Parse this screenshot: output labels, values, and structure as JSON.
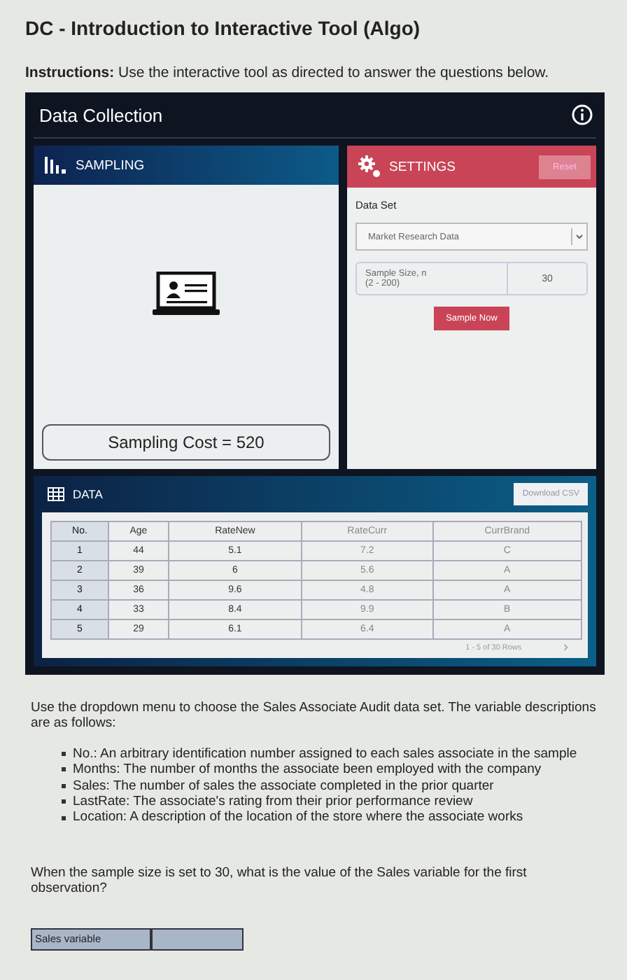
{
  "title": "DC - Introduction to Interactive Tool (Algo)",
  "instructions": "**Instructions:** Use the interactive tool as directed to answer the questions below.",
  "tool": {
    "title": "Data Collection",
    "sampling": {
      "header": "SAMPLING",
      "cost": "Sampling Cost = 520"
    },
    "settings": {
      "header": "SETTINGS",
      "reset": "Reset",
      "dataset_label": "Data Set",
      "dataset_value": "Market Research Data",
      "size_label": "Sample Size, n",
      "size_range": "(2 - 200)",
      "size_value": "30",
      "sample_button": "Sample Now"
    },
    "data": {
      "header": "DATA",
      "download": "Download CSV",
      "columns": [
        "No.",
        "Age",
        "RateNew",
        "RateCurr",
        "CurrBrand"
      ],
      "rows": [
        [
          "1",
          "44",
          "5.1",
          "7.2",
          "C"
        ],
        [
          "2",
          "39",
          "6",
          "5.6",
          "A"
        ],
        [
          "3",
          "36",
          "9.6",
          "4.8",
          "A"
        ],
        [
          "4",
          "33",
          "8.4",
          "9.9",
          "B"
        ],
        [
          "5",
          "29",
          "6.1",
          "6.4",
          "A"
        ]
      ],
      "pager": "1 - 5 of 30 Rows",
      "next": "›"
    }
  },
  "intro": "Use the dropdown menu to choose the Sales Associate Audit data set. The variable descriptions are as follows:",
  "bullets": [
    "No.: An arbitrary identification number assigned to each sales associate in the sample",
    "Months: The number of months the associate been employed with the company",
    "Sales: The number of sales the associate completed in the prior quarter",
    "LastRate: The associate's rating from their prior performance review",
    "Location: A description of the location of the store where the associate works"
  ],
  "question": "When the sample size is set to 30, what is the value of the Sales variable for the first observation?",
  "answer": {
    "label": "Sales variable"
  }
}
